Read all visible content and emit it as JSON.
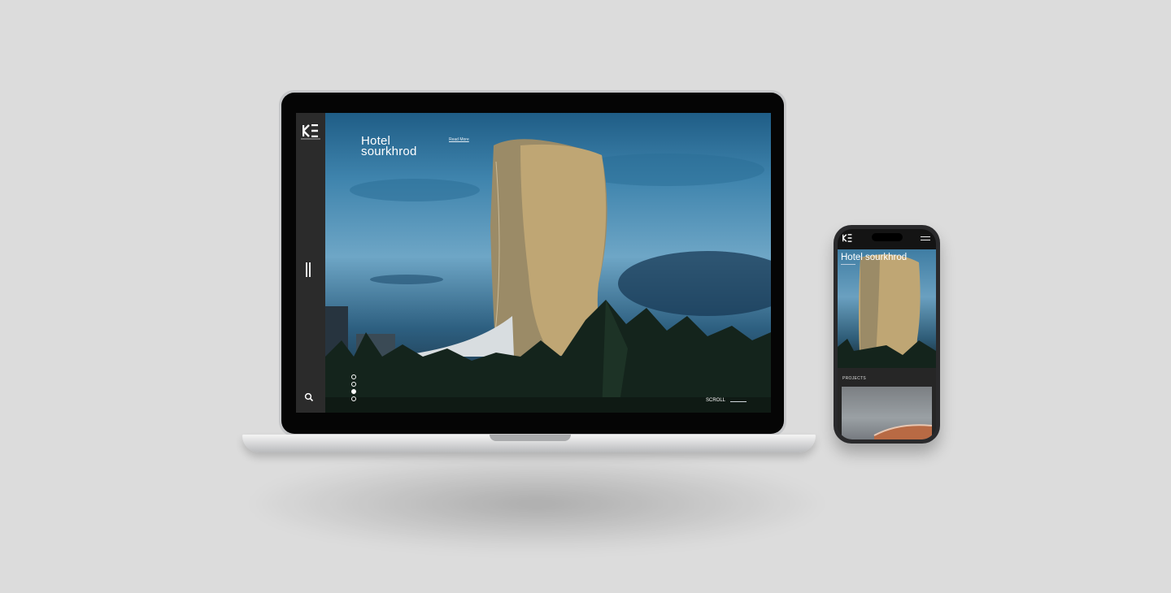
{
  "laptop_site": {
    "hero": {
      "title_line1": "Hotel",
      "title_line2": "sourkhrod",
      "read_more": "Read More",
      "scroll_label": "SCROLL",
      "slide_count": 4,
      "active_slide": 3
    },
    "sidebar": {
      "logo_icon": "kb-logo-icon",
      "menu_icon": "vertical-menu-icon",
      "search_icon": "search-icon"
    }
  },
  "phone_site": {
    "hero_title": "Hotel sourkhrod",
    "section_label": "PROJECTS",
    "menu_icon": "hamburger-icon"
  },
  "colors": {
    "sidebar": "#2b2b2b",
    "background": "#dcdcdc",
    "text_on_hero": "#ffffff"
  }
}
